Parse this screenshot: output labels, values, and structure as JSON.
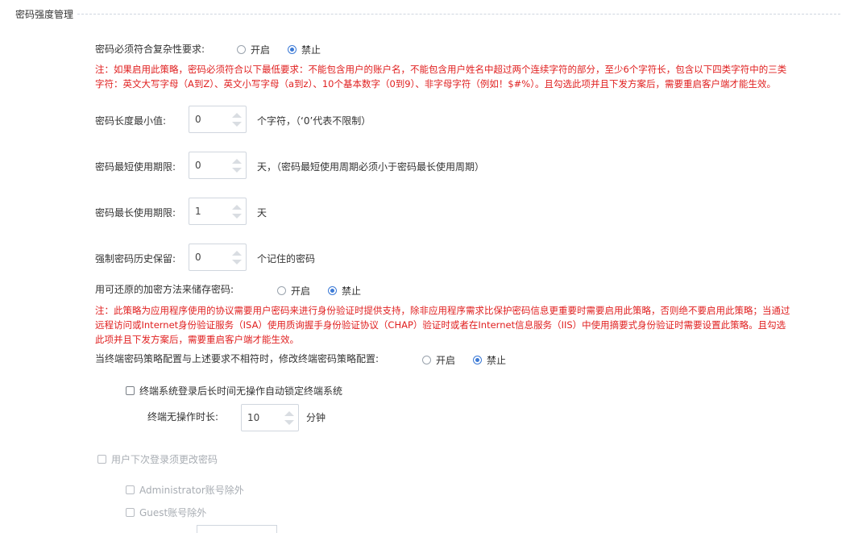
{
  "section": {
    "title": "密码强度管理"
  },
  "complexity": {
    "label": "密码必须符合复杂性要求:",
    "option_on": "开启",
    "option_off": "禁止",
    "selected": "禁止",
    "note_line1": "注：如果启用此策略，密码必须符合以下最低要求：不能包含用户的账户名，不能包含用户姓名中超过两个连续字符的部分，至少6个字符长，包含以下四类字符中的三类",
    "note_line2": "字符：英文大写字母（A到Z）、英文小写字母（a到z）、10个基本数字（0到9）、非字母字符（例如！$#%）。且勾选此项并且下发方案后，需要重启客户端才能生效。"
  },
  "min_length": {
    "label": "密码长度最小值:",
    "value": "0",
    "suffix": "个字符，（‘0’代表不限制）"
  },
  "min_age": {
    "label": "密码最短使用期限:",
    "value": "0",
    "suffix": "天，（密码最短使用周期必须小于密码最长使用周期）"
  },
  "max_age": {
    "label": "密码最长使用期限:",
    "value": "1",
    "suffix": "天"
  },
  "history": {
    "label": "强制密码历史保留:",
    "value": "0",
    "suffix": "个记住的密码"
  },
  "reversible": {
    "label": "用可还原的加密方法来储存密码:",
    "option_on": "开启",
    "option_off": "禁止",
    "selected": "禁止",
    "note_line1": "注：此策略为应用程序使用的协议需要用户密码来进行身份验证时提供支持，除非应用程序需求比保护密码信息更重要时需要启用此策略，否则绝不要启用此策略；当通过",
    "note_line2": "远程访问或Internet身份验证服务（ISA）使用质询握手身份验证协议（CHAP）验证时或者在Internet信息服务（IIS）中使用摘要式身份验证时需要设置此策略。且勾选",
    "note_line3": "此项并且下发方案后，需要重启客户端才能生效。"
  },
  "terminal_policy": {
    "label": "当终端密码策略配置与上述要求不相符时，修改终端密码策略配置:",
    "option_on": "开启",
    "option_off": "禁止",
    "selected": "禁止"
  },
  "auto_lock": {
    "checkbox_label": "终端系统登录后长时间无操作自动锁定终端系统",
    "idle_label": "终端无操作时长:",
    "idle_value": "10",
    "idle_unit": "分钟"
  },
  "change_next_login": {
    "checkbox_label": "用户下次登录须更改密码",
    "admin_label": "Administrator账号除外",
    "guest_label": "Guest账号除外"
  },
  "colors": {
    "accent": "#3c7ad6",
    "note": "#e02020",
    "disabled": "#a8adb3"
  }
}
